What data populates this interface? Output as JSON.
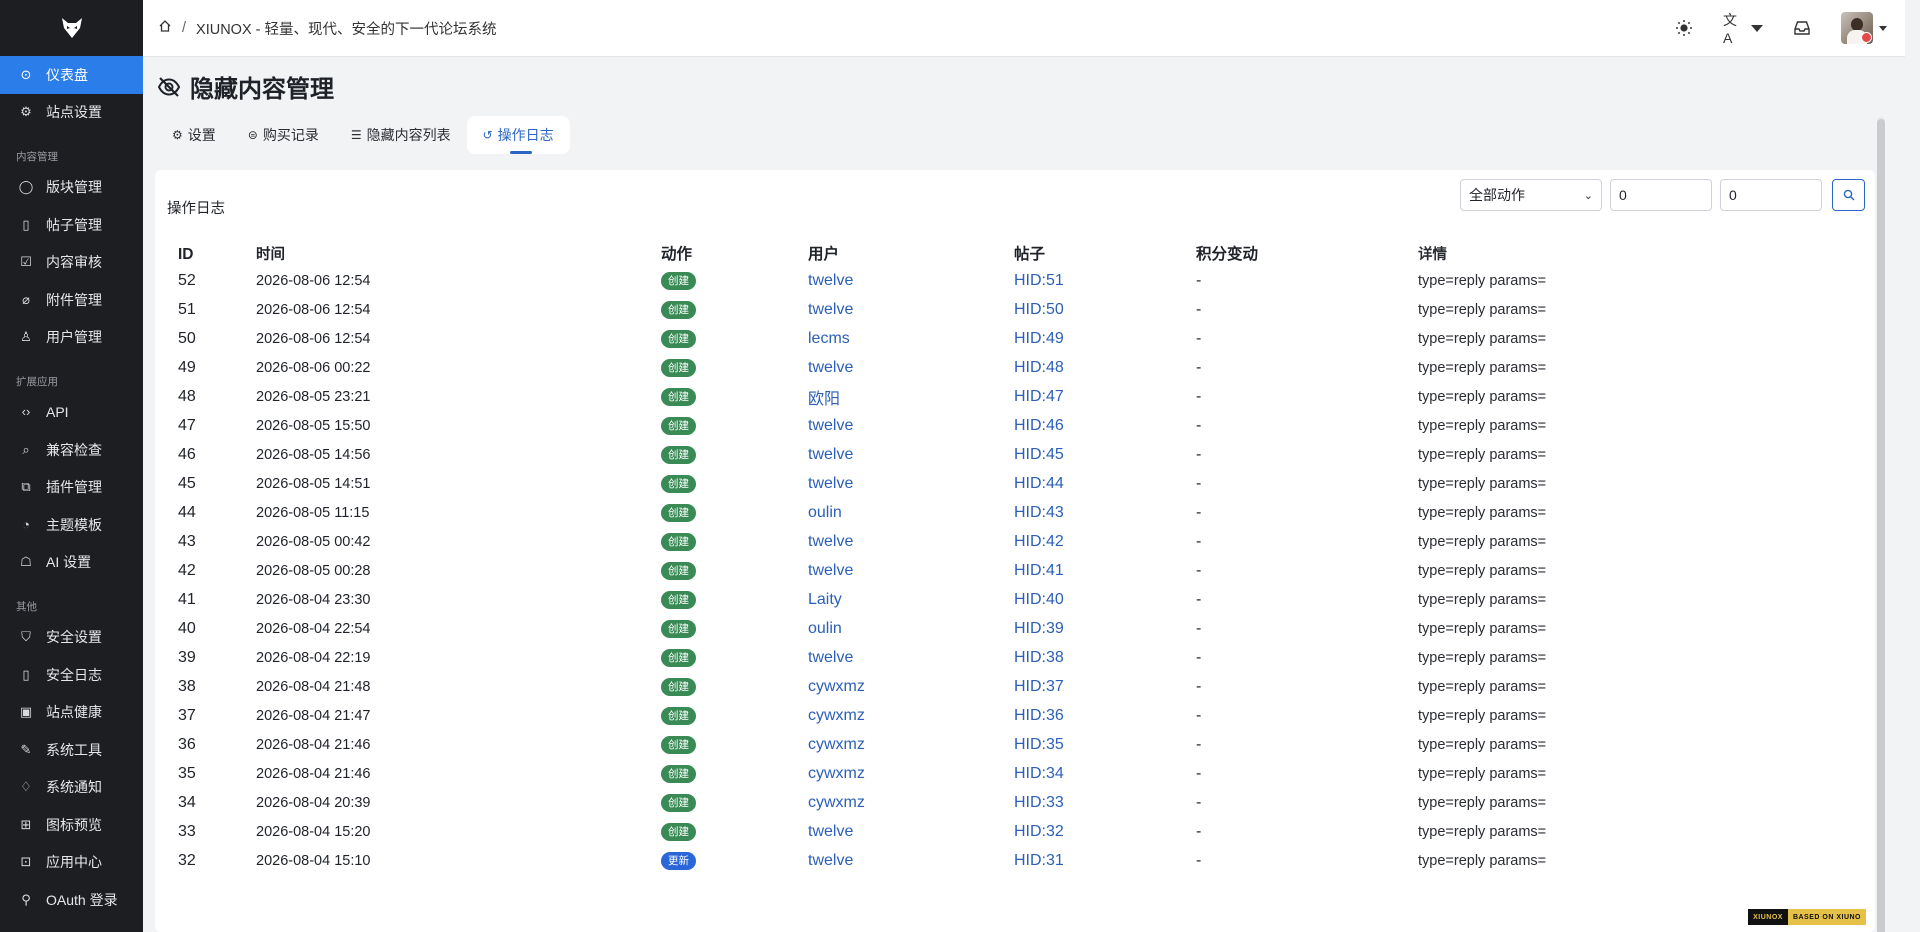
{
  "sidebar": {
    "items": [
      {
        "label": "仪表盘",
        "icon": "dashboard-icon",
        "active": true
      },
      {
        "label": "站点设置",
        "icon": "gear-icon"
      }
    ],
    "sections": [
      {
        "title": "内容管理",
        "items": [
          {
            "label": "版块管理",
            "icon": "chat-bubble-icon"
          },
          {
            "label": "帖子管理",
            "icon": "document-icon"
          },
          {
            "label": "内容审核",
            "icon": "clipboard-check-icon"
          },
          {
            "label": "附件管理",
            "icon": "paperclip-icon"
          },
          {
            "label": "用户管理",
            "icon": "users-icon"
          }
        ]
      },
      {
        "title": "扩展应用",
        "items": [
          {
            "label": "API",
            "icon": "code-icon"
          },
          {
            "label": "兼容检查",
            "icon": "search-icon"
          },
          {
            "label": "插件管理",
            "icon": "puzzle-icon"
          },
          {
            "label": "主题模板",
            "icon": "palette-icon"
          },
          {
            "label": "AI 设置",
            "icon": "robot-icon"
          }
        ]
      },
      {
        "title": "其他",
        "items": [
          {
            "label": "安全设置",
            "icon": "shield-icon"
          },
          {
            "label": "安全日志",
            "icon": "document-icon"
          },
          {
            "label": "站点健康",
            "icon": "heart-monitor-icon"
          },
          {
            "label": "系统工具",
            "icon": "wrench-icon"
          },
          {
            "label": "系统通知",
            "icon": "bell-icon"
          },
          {
            "label": "图标预览",
            "icon": "grid-icon"
          },
          {
            "label": "应用中心",
            "icon": "apps-icon"
          },
          {
            "label": "OAuth 登录",
            "icon": "plug-icon"
          }
        ]
      }
    ]
  },
  "header": {
    "breadcrumb_sep": "/",
    "breadcrumb_title": "XIUNOX - 轻量、现代、安全的下一代论坛系统"
  },
  "page": {
    "title": "隐藏内容管理",
    "tabs": [
      {
        "label": "设置",
        "icon": "gear-icon"
      },
      {
        "label": "购买记录",
        "icon": "coin-icon"
      },
      {
        "label": "隐藏内容列表",
        "icon": "list-icon"
      },
      {
        "label": "操作日志",
        "icon": "history-icon",
        "active": true
      }
    ]
  },
  "log": {
    "card_title": "操作日志",
    "filter": {
      "action_select": "全部动作",
      "uid_value": "0",
      "tid_value": "0"
    },
    "columns": [
      "ID",
      "时间",
      "动作",
      "用户",
      "帖子",
      "积分变动",
      "详情"
    ],
    "rows": [
      {
        "id": "52",
        "time": "2026-08-06 12:54",
        "action": "创建",
        "type": "create",
        "user": "twelve",
        "post": "HID:51",
        "points": "-",
        "detail": "type=reply params="
      },
      {
        "id": "51",
        "time": "2026-08-06 12:54",
        "action": "创建",
        "type": "create",
        "user": "twelve",
        "post": "HID:50",
        "points": "-",
        "detail": "type=reply params="
      },
      {
        "id": "50",
        "time": "2026-08-06 12:54",
        "action": "创建",
        "type": "create",
        "user": "lecms",
        "post": "HID:49",
        "points": "-",
        "detail": "type=reply params="
      },
      {
        "id": "49",
        "time": "2026-08-06 00:22",
        "action": "创建",
        "type": "create",
        "user": "twelve",
        "post": "HID:48",
        "points": "-",
        "detail": "type=reply params="
      },
      {
        "id": "48",
        "time": "2026-08-05 23:21",
        "action": "创建",
        "type": "create",
        "user": "欧阳",
        "post": "HID:47",
        "points": "-",
        "detail": "type=reply params="
      },
      {
        "id": "47",
        "time": "2026-08-05 15:50",
        "action": "创建",
        "type": "create",
        "user": "twelve",
        "post": "HID:46",
        "points": "-",
        "detail": "type=reply params="
      },
      {
        "id": "46",
        "time": "2026-08-05 14:56",
        "action": "创建",
        "type": "create",
        "user": "twelve",
        "post": "HID:45",
        "points": "-",
        "detail": "type=reply params="
      },
      {
        "id": "45",
        "time": "2026-08-05 14:51",
        "action": "创建",
        "type": "create",
        "user": "twelve",
        "post": "HID:44",
        "points": "-",
        "detail": "type=reply params="
      },
      {
        "id": "44",
        "time": "2026-08-05 11:15",
        "action": "创建",
        "type": "create",
        "user": "oulin",
        "post": "HID:43",
        "points": "-",
        "detail": "type=reply params="
      },
      {
        "id": "43",
        "time": "2026-08-05 00:42",
        "action": "创建",
        "type": "create",
        "user": "twelve",
        "post": "HID:42",
        "points": "-",
        "detail": "type=reply params="
      },
      {
        "id": "42",
        "time": "2026-08-05 00:28",
        "action": "创建",
        "type": "create",
        "user": "twelve",
        "post": "HID:41",
        "points": "-",
        "detail": "type=reply params="
      },
      {
        "id": "41",
        "time": "2026-08-04 23:30",
        "action": "创建",
        "type": "create",
        "user": "Laity",
        "post": "HID:40",
        "points": "-",
        "detail": "type=reply params="
      },
      {
        "id": "40",
        "time": "2026-08-04 22:54",
        "action": "创建",
        "type": "create",
        "user": "oulin",
        "post": "HID:39",
        "points": "-",
        "detail": "type=reply params="
      },
      {
        "id": "39",
        "time": "2026-08-04 22:19",
        "action": "创建",
        "type": "create",
        "user": "twelve",
        "post": "HID:38",
        "points": "-",
        "detail": "type=reply params="
      },
      {
        "id": "38",
        "time": "2026-08-04 21:48",
        "action": "创建",
        "type": "create",
        "user": "cywxmz",
        "post": "HID:37",
        "points": "-",
        "detail": "type=reply params="
      },
      {
        "id": "37",
        "time": "2026-08-04 21:47",
        "action": "创建",
        "type": "create",
        "user": "cywxmz",
        "post": "HID:36",
        "points": "-",
        "detail": "type=reply params="
      },
      {
        "id": "36",
        "time": "2026-08-04 21:46",
        "action": "创建",
        "type": "create",
        "user": "cywxmz",
        "post": "HID:35",
        "points": "-",
        "detail": "type=reply params="
      },
      {
        "id": "35",
        "time": "2026-08-04 21:46",
        "action": "创建",
        "type": "create",
        "user": "cywxmz",
        "post": "HID:34",
        "points": "-",
        "detail": "type=reply params="
      },
      {
        "id": "34",
        "time": "2026-08-04 20:39",
        "action": "创建",
        "type": "create",
        "user": "cywxmz",
        "post": "HID:33",
        "points": "-",
        "detail": "type=reply params="
      },
      {
        "id": "33",
        "time": "2026-08-04 15:20",
        "action": "创建",
        "type": "create",
        "user": "twelve",
        "post": "HID:32",
        "points": "-",
        "detail": "type=reply params="
      },
      {
        "id": "32",
        "time": "2026-08-04 15:10",
        "action": "更新",
        "type": "update",
        "user": "twelve",
        "post": "HID:31",
        "points": "-",
        "detail": "type=reply params="
      }
    ]
  },
  "footer": {
    "badge_left": "XIUNOX",
    "badge_right": "BASED ON XIUNO"
  },
  "colors": {
    "accent": "#2b66c7",
    "sidebar_bg": "#1d1e22",
    "sidebar_active": "#2b7de9",
    "badge_create": "#3a8a56",
    "badge_update": "#2b66d8"
  }
}
